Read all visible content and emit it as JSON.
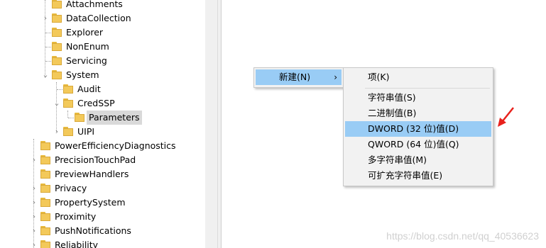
{
  "tree": {
    "items": [
      {
        "label": "Attachments"
      },
      {
        "label": "DataCollection"
      },
      {
        "label": "Explorer"
      },
      {
        "label": "NonEnum"
      },
      {
        "label": "Servicing"
      },
      {
        "label": "System"
      },
      {
        "label": "Audit"
      },
      {
        "label": "CredSSP"
      },
      {
        "label": "Parameters"
      },
      {
        "label": "UIPI"
      },
      {
        "label": "PowerEfficiencyDiagnostics"
      },
      {
        "label": "PrecisionTouchPad"
      },
      {
        "label": "PreviewHandlers"
      },
      {
        "label": "Privacy"
      },
      {
        "label": "PropertySystem"
      },
      {
        "label": "Proximity"
      },
      {
        "label": "PushNotifications"
      },
      {
        "label": "Reliability"
      }
    ]
  },
  "context_menu": {
    "new_label": "新建(N)",
    "submenu_items": [
      {
        "label": "项(K)"
      },
      {
        "label": "字符串值(S)"
      },
      {
        "label": "二进制值(B)"
      },
      {
        "label": "DWORD (32 位)值(D)"
      },
      {
        "label": "QWORD (64 位)值(Q)"
      },
      {
        "label": "多字符串值(M)"
      },
      {
        "label": "可扩充字符串值(E)"
      }
    ]
  },
  "watermark": "https://blog.csdn.net/qq_40536623",
  "colors": {
    "highlight": "#99ccf5",
    "arrow": "#e8211c",
    "folder": "#f3c95a"
  }
}
